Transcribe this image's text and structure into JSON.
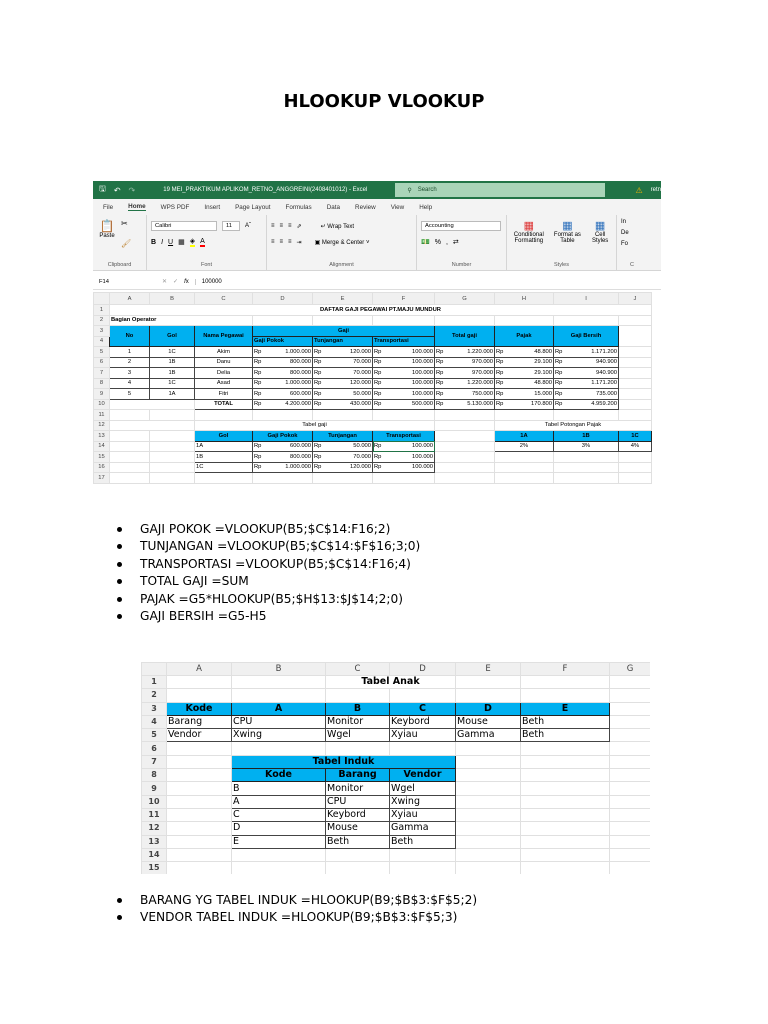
{
  "doc_title": "HLOOKUP VLOOKUP",
  "formulas_1": [
    "GAJI POKOK =VLOOKUP(B5;$C$14:F16;2)",
    "TUNJANGAN =VLOOKUP(B5;$C$14:$F$16;3;0)",
    "TRANSPORTASI =VLOOKUP(B5;$C$14:F16;4)",
    "TOTAL GAJI =SUM",
    "PAJAK =G5*HLOOKUP(B5;$H$13:$J$14;2;0)",
    "GAJI BERSIH =G5-H5"
  ],
  "formulas_2": [
    "BARANG YG TABEL INDUK =HLOOKUP(B9;$B$3:$F$5;2)",
    "VENDOR TABEL INDUK =HLOOKUP(B9;$B$3:$F$5;3)"
  ],
  "excel": {
    "file_title": "19 MEI_PRAKTIKUM APLIKOM_RETNO_ANGGREINI(2408401012)  -  Excel",
    "search": "Search",
    "user": "retn",
    "tabs": [
      "File",
      "Home",
      "WPS PDF",
      "Insert",
      "Page Layout",
      "Formulas",
      "Data",
      "Review",
      "View",
      "Help"
    ],
    "ribbon": {
      "paste": "Paste",
      "font": "Calibri",
      "size": "11",
      "wrap": "Wrap Text",
      "merge": "Merge & Center",
      "number_format": "Accounting",
      "cond": "Conditional Formatting",
      "fmt_table": "Format as Table",
      "cell_styles": "Cell Styles",
      "cells": [
        "In",
        "De",
        "Fo"
      ],
      "groups": [
        "Clipboard",
        "Font",
        "Alignment",
        "Number",
        "Styles",
        "C"
      ]
    },
    "name_box": "F14",
    "formula_value": "100000"
  },
  "s1": {
    "columns": [
      "A",
      "B",
      "C",
      "D",
      "E",
      "F",
      "G",
      "H",
      "I",
      "J"
    ],
    "rows": [
      "1",
      "2",
      "3",
      "4",
      "5",
      "6",
      "7",
      "8",
      "9",
      "10",
      "11",
      "12",
      "13",
      "14",
      "15",
      "16",
      "17"
    ],
    "title_row": "DAFTAR GAJI PEGAWAI PT.MAJU MUNDUR",
    "section": "Bagian Operator",
    "cur": "Rp",
    "h": {
      "no": "No",
      "gol": "Gol",
      "nama": "Nama Pegawai",
      "gaji": "Gaji",
      "pokok": "Gaji Pokok",
      "tunj": "Tunjangan",
      "trans": "Transportasi",
      "total": "Total gaji",
      "pajak": "Pajak",
      "bersih": "Gaji Bersih"
    },
    "emp": [
      {
        "no": "1",
        "gol": "1C",
        "nama": "Akim",
        "pokok": "1.000.000",
        "tunj": "120.000",
        "trans": "100.000",
        "total": "1.220.000",
        "pajak": "48.800",
        "bersih": "1.171.200"
      },
      {
        "no": "2",
        "gol": "1B",
        "nama": "Danu",
        "pokok": "800.000",
        "tunj": "70.000",
        "trans": "100.000",
        "total": "970.000",
        "pajak": "29.100",
        "bersih": "940.900"
      },
      {
        "no": "3",
        "gol": "1B",
        "nama": "Delia",
        "pokok": "800.000",
        "tunj": "70.000",
        "trans": "100.000",
        "total": "970.000",
        "pajak": "29.100",
        "bersih": "940.900"
      },
      {
        "no": "4",
        "gol": "1C",
        "nama": "Asad",
        "pokok": "1.000.000",
        "tunj": "120.000",
        "trans": "100.000",
        "total": "1.220.000",
        "pajak": "48.800",
        "bersih": "1.171.200"
      },
      {
        "no": "5",
        "gol": "1A",
        "nama": "Fitri",
        "pokok": "600.000",
        "tunj": "50.000",
        "trans": "100.000",
        "total": "750.000",
        "pajak": "15.000",
        "bersih": "735.000"
      }
    ],
    "totals": {
      "label": "TOTAL",
      "pokok": "4.200.000",
      "tunj": "430.000",
      "trans": "500.000",
      "total": "5.130.000",
      "pajak": "170.800",
      "bersih": "4.959.200"
    },
    "gaji_table": {
      "title": "Tabel gaji",
      "headers": [
        "Gol",
        "Gaji Pokok",
        "Tunjangan",
        "Transportasi"
      ],
      "rows": [
        {
          "gol": "1A",
          "pokok": "600.000",
          "tunj": "50.000",
          "trans": "100.000"
        },
        {
          "gol": "1B",
          "pokok": "800.000",
          "tunj": "70.000",
          "trans": "100.000"
        },
        {
          "gol": "1C",
          "pokok": "1.000.000",
          "tunj": "120.000",
          "trans": "100.000"
        }
      ]
    },
    "pajak_table": {
      "title": "Tabel Potongan Pajak",
      "headers": [
        "1A",
        "1B",
        "1C"
      ],
      "values": [
        "2%",
        "3%",
        "4%"
      ]
    }
  },
  "s2": {
    "columns": [
      "A",
      "B",
      "C",
      "D",
      "E",
      "F",
      "G"
    ],
    "rows": [
      "1",
      "2",
      "3",
      "4",
      "5",
      "6",
      "7",
      "8",
      "9",
      "10",
      "11",
      "12",
      "13",
      "14",
      "15"
    ],
    "anak": {
      "title": "Tabel Anak",
      "header": [
        "Kode",
        "A",
        "B",
        "C",
        "D",
        "E"
      ],
      "rows": [
        [
          "Barang",
          "CPU",
          "Monitor",
          "Keybord",
          "Mouse",
          "Beth"
        ],
        [
          "Vendor",
          "Xwing",
          "Wgel",
          "Xyiau",
          "Gamma",
          "Beth"
        ]
      ]
    },
    "induk": {
      "title": "Tabel Induk",
      "header": [
        "Kode",
        "Barang",
        "Vendor"
      ],
      "rows": [
        [
          "B",
          "Monitor",
          "Wgel"
        ],
        [
          "A",
          "CPU",
          "Xwing"
        ],
        [
          "C",
          "Keybord",
          "Xyiau"
        ],
        [
          "D",
          "Mouse",
          "Gamma"
        ],
        [
          "E",
          "Beth",
          "Beth"
        ]
      ]
    }
  }
}
